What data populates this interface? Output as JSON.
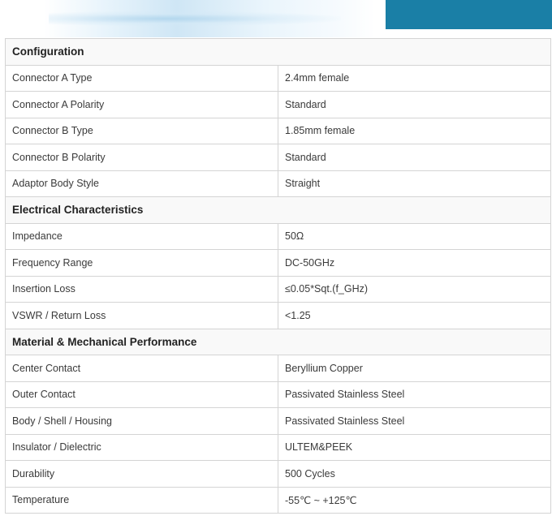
{
  "colors": {
    "banner_accent": "#1a7fa6",
    "border": "#d4d4d4",
    "text": "#3a3a3a"
  },
  "sections": [
    {
      "title": "Configuration",
      "rows": [
        {
          "label": "Connector A Type",
          "value": "2.4mm female"
        },
        {
          "label": "Connector A Polarity",
          "value": "Standard"
        },
        {
          "label": "Connector B Type",
          "value": "1.85mm female"
        },
        {
          "label": "Connector B Polarity",
          "value": "Standard"
        },
        {
          "label": "Adaptor Body Style",
          "value": "Straight"
        }
      ]
    },
    {
      "title": "Electrical Characteristics",
      "rows": [
        {
          "label": "Impedance",
          "value": "50Ω"
        },
        {
          "label": "Frequency Range",
          "value": "DC-50GHz"
        },
        {
          "label": "Insertion Loss",
          "value": "≤0.05*Sqt.(f_GHz)"
        },
        {
          "label": "VSWR / Return Loss",
          "value": "<1.25"
        }
      ]
    },
    {
      "title": "Material & Mechanical Performance",
      "rows": [
        {
          "label": "Center Contact",
          "value": "Beryllium Copper"
        },
        {
          "label": "Outer Contact",
          "value": "Passivated Stainless Steel"
        },
        {
          "label": "Body / Shell / Housing",
          "value": "Passivated Stainless Steel"
        },
        {
          "label": "Insulator / Dielectric",
          "value": "ULTEM&PEEK"
        },
        {
          "label": "Durability",
          "value": "500 Cycles"
        },
        {
          "label": "Temperature",
          "value": "-55℃ ~ +125℃"
        }
      ]
    }
  ]
}
